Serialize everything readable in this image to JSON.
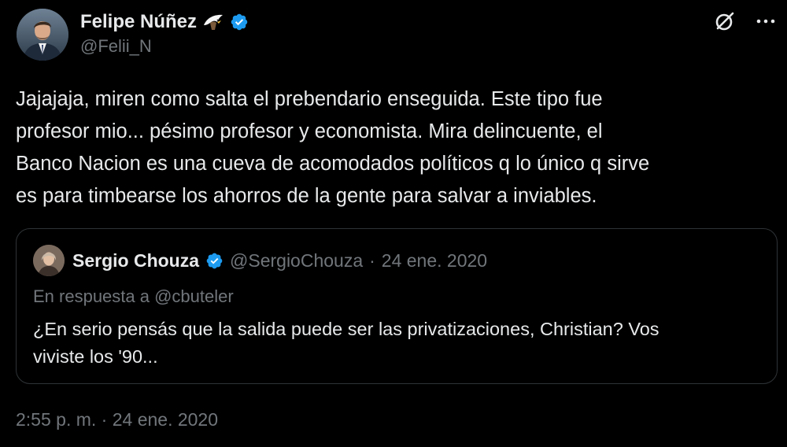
{
  "author": {
    "display_name": "Felipe Núñez",
    "handle": "@Felii_N",
    "badge_icon": "eagle-icon",
    "verified_icon": "verified-badge-icon",
    "verified_color": "#1d9bf0"
  },
  "top_actions": {
    "icons": [
      "grok-icon",
      "more-options-icon"
    ]
  },
  "tweet": {
    "text": "Jajajaja, miren como salta el prebendario enseguida. Este tipo fue\nprofesor mio... pésimo profesor y economista. Mira delincuente, el\nBanco Nacion es una cueva de acomodados políticos q lo único q sirve\nes para timbearse los ahorros de la gente para salvar a inviables."
  },
  "quoted_tweet": {
    "display_name": "Sergio Chouza",
    "handle": "@SergioChouza",
    "separator": "·",
    "date": "24 ene. 2020",
    "reply_to": "En respuesta a @cbuteler",
    "text": "¿En serio pensás que la salida puede ser las privatizaciones, Christian? Vos\nviviste los '90..."
  },
  "timestamp": "2:55 p. m. · 24 ene. 2020",
  "colors": {
    "background": "#000000",
    "primary_text": "#e7e9ea",
    "secondary_text": "#71767b",
    "border": "#2f3336",
    "verified": "#1d9bf0"
  }
}
